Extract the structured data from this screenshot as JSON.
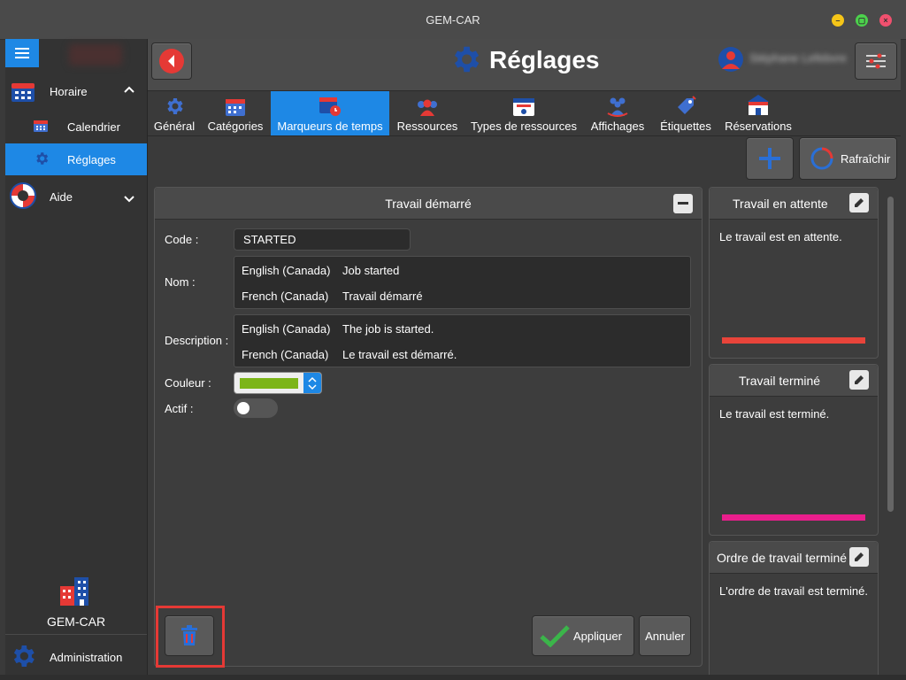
{
  "window": {
    "title": "GEM-CAR"
  },
  "sidebar": {
    "items": [
      {
        "label": "Horaire"
      },
      {
        "label": "Calendrier"
      },
      {
        "label": "Réglages"
      },
      {
        "label": "Aide"
      }
    ],
    "app_name": "GEM-CAR",
    "admin_label": "Administration"
  },
  "header": {
    "title": "Réglages",
    "user_name": "Stéphane Lefebvre"
  },
  "tabs": [
    {
      "label": "Général"
    },
    {
      "label": "Catégories"
    },
    {
      "label": "Marqueurs de temps"
    },
    {
      "label": "Ressources"
    },
    {
      "label": "Types de ressources"
    },
    {
      "label": "Affichages"
    },
    {
      "label": "Étiquettes"
    },
    {
      "label": "Réservations"
    }
  ],
  "toolbar": {
    "refresh_label": "Rafraîchir"
  },
  "editor": {
    "title": "Travail démarré",
    "code_label": "Code :",
    "code_value": "STARTED",
    "name_label": "Nom :",
    "name_rows": [
      {
        "lang": "English (Canada)",
        "value": "Job started"
      },
      {
        "lang": "French (Canada)",
        "value": "Travail démarré"
      }
    ],
    "description_label": "Description :",
    "description_rows": [
      {
        "lang": "English (Canada)",
        "value": "The job is started."
      },
      {
        "lang": "French (Canada)",
        "value": "Le travail est démarré."
      }
    ],
    "color_label": "Couleur :",
    "color_value": "#7cb518",
    "active_label": "Actif :",
    "active": false,
    "apply_label": "Appliquer",
    "cancel_label": "Annuler"
  },
  "cards": [
    {
      "title": "Travail en attente",
      "description": "Le travail est en attente.",
      "color": "#e8443a"
    },
    {
      "title": "Travail terminé",
      "description": "Le travail est terminé.",
      "color": "#e91e8c"
    },
    {
      "title": "Ordre de travail terminé",
      "description": "L'ordre de travail est terminé."
    }
  ],
  "colors": {
    "accent": "#1e88e5",
    "danger": "#e53935",
    "highlight": "#e53935"
  }
}
